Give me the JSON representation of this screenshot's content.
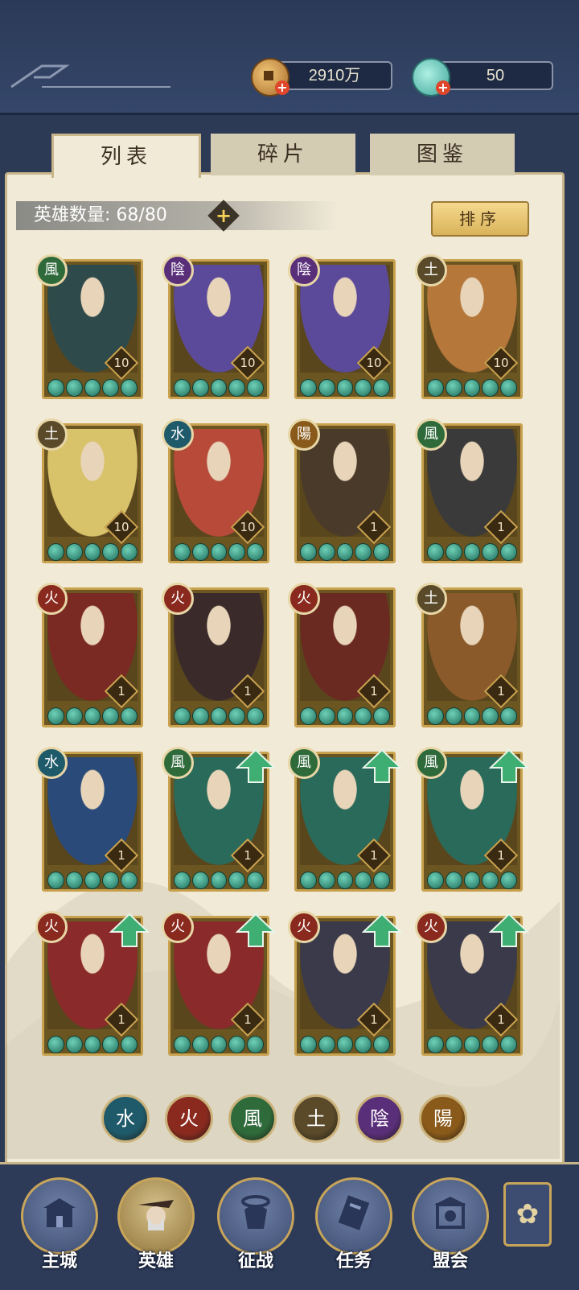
{
  "header": {
    "gold": {
      "value": "2910万",
      "icon": "gold-coin-icon"
    },
    "jade": {
      "value": "50",
      "icon": "jade-shell-icon"
    }
  },
  "tabs": [
    {
      "label": "列表",
      "active": true
    },
    {
      "label": "碎片",
      "active": false
    },
    {
      "label": "图鉴",
      "active": false
    }
  ],
  "hero_count": {
    "label": "英雄数量:",
    "value": "68/80",
    "plus": "+"
  },
  "sort_button": "排序",
  "heroes": [
    {
      "element": "風",
      "color": "#2f6a3b",
      "level": "10",
      "upgrade": false,
      "art": "#2f4a4a"
    },
    {
      "element": "陰",
      "color": "#5a2f7a",
      "level": "10",
      "upgrade": false,
      "art": "#5b4a9a"
    },
    {
      "element": "陰",
      "color": "#5a2f7a",
      "level": "10",
      "upgrade": false,
      "art": "#5b4a9a"
    },
    {
      "element": "土",
      "color": "#5a4a2a",
      "level": "10",
      "upgrade": false,
      "art": "#b5773a"
    },
    {
      "element": "土",
      "color": "#5a4a2a",
      "level": "10",
      "upgrade": false,
      "art": "#d8c26a"
    },
    {
      "element": "水",
      "color": "#1f5a6a",
      "level": "10",
      "upgrade": false,
      "art": "#b84a3a"
    },
    {
      "element": "陽",
      "color": "#8a5a1a",
      "level": "1",
      "upgrade": false,
      "art": "#4a3a2a"
    },
    {
      "element": "風",
      "color": "#2f6a3b",
      "level": "1",
      "upgrade": false,
      "art": "#3a3a3a"
    },
    {
      "element": "火",
      "color": "#8a2a1f",
      "level": "1",
      "upgrade": false,
      "art": "#7a2a22"
    },
    {
      "element": "火",
      "color": "#8a2a1f",
      "level": "1",
      "upgrade": false,
      "art": "#3a2a2a"
    },
    {
      "element": "火",
      "color": "#8a2a1f",
      "level": "1",
      "upgrade": false,
      "art": "#6a2a22"
    },
    {
      "element": "土",
      "color": "#5a4a2a",
      "level": "1",
      "upgrade": false,
      "art": "#8a5a2a"
    },
    {
      "element": "水",
      "color": "#1f5a6a",
      "level": "1",
      "upgrade": false,
      "art": "#2a4a7a"
    },
    {
      "element": "風",
      "color": "#2f6a3b",
      "level": "1",
      "upgrade": true,
      "art": "#2a6a5a"
    },
    {
      "element": "風",
      "color": "#2f6a3b",
      "level": "1",
      "upgrade": true,
      "art": "#2a6a5a"
    },
    {
      "element": "風",
      "color": "#2f6a3b",
      "level": "1",
      "upgrade": true,
      "art": "#2a6a5a"
    },
    {
      "element": "火",
      "color": "#8a2a1f",
      "level": "1",
      "upgrade": true,
      "art": "#8a2a2a"
    },
    {
      "element": "火",
      "color": "#8a2a1f",
      "level": "1",
      "upgrade": true,
      "art": "#8a2a2a"
    },
    {
      "element": "火",
      "color": "#8a2a1f",
      "level": "1",
      "upgrade": true,
      "art": "#3a3a4a"
    },
    {
      "element": "火",
      "color": "#8a2a1f",
      "level": "1",
      "upgrade": true,
      "art": "#3a3a4a"
    }
  ],
  "filters": [
    {
      "element": "水",
      "color": "#1f5a6a"
    },
    {
      "element": "火",
      "color": "#8a2a1f"
    },
    {
      "element": "風",
      "color": "#2f6a3b"
    },
    {
      "element": "土",
      "color": "#5a4a2a"
    },
    {
      "element": "陰",
      "color": "#5a2f7a"
    },
    {
      "element": "陽",
      "color": "#8a5a1a"
    }
  ],
  "nav": [
    {
      "label": "主城",
      "icon": "city-gate-icon",
      "active": false
    },
    {
      "label": "英雄",
      "icon": "hero-portrait-icon",
      "active": true
    },
    {
      "label": "征战",
      "icon": "battle-helmet-icon",
      "active": false
    },
    {
      "label": "任务",
      "icon": "scroll-task-icon",
      "active": false
    },
    {
      "label": "盟会",
      "icon": "guild-hall-icon",
      "active": false
    }
  ],
  "more_icon": "flower-menu-icon"
}
